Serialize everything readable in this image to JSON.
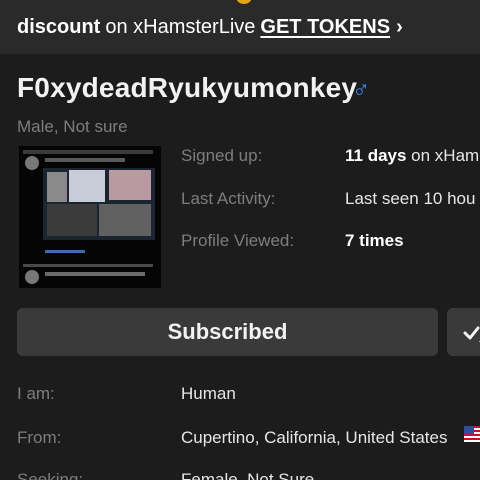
{
  "promo": {
    "strong": "discount",
    "text": "on xHamsterLive",
    "cta": "GET TOKENS",
    "chevron": "›"
  },
  "profile": {
    "username": "F0xydeadRyukyumonkey",
    "gender_icon": "male-symbol-icon",
    "gender_symbol": "♂",
    "subtitle": "Male, Not sure"
  },
  "stats": {
    "signed_up_label": "Signed up:",
    "signed_up_strong": "11 days",
    "signed_up_rest": " on xHam",
    "last_activity_label": "Last Activity:",
    "last_activity_value": "Last seen 10 hou",
    "profile_viewed_label": "Profile Viewed:",
    "profile_viewed_strong": "7 times"
  },
  "actions": {
    "subscribe_label": "Subscribed",
    "secondary_icon": "user-check-icon"
  },
  "details": {
    "i_am_label": "I am:",
    "i_am_value": "Human",
    "from_label": "From:",
    "from_value": "Cupertino, California, United States",
    "from_flag_icon": "us-flag-icon",
    "seeking_label": "Seeking:",
    "seeking_value": "Female, Not Sure"
  },
  "colors": {
    "background": "#1c1c1c",
    "banner": "#2a2a2a",
    "button": "#3a3a3a",
    "muted_text": "#7d7d7d",
    "male_icon": "#3b8fe6"
  }
}
